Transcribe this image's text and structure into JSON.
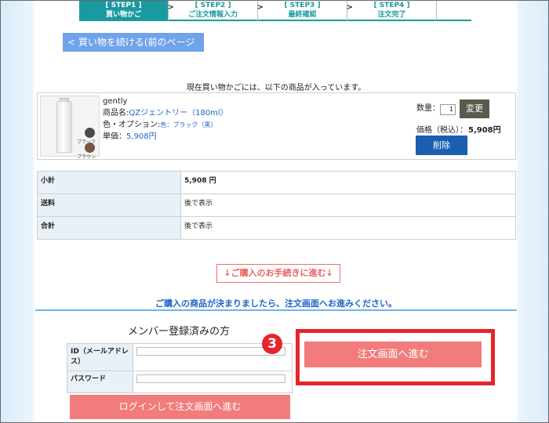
{
  "steps": [
    {
      "tag": "[ STEP1 ]",
      "label": "買い物かご",
      "active": true
    },
    {
      "tag": "[ STEP2 ]",
      "label": "ご注文情報入力",
      "active": false
    },
    {
      "tag": "[ STEP3 ]",
      "label": "最終確認",
      "active": false
    },
    {
      "tag": "[ STEP4 ]",
      "label": "注文完了",
      "active": false
    }
  ],
  "step_arrow": ">",
  "continue_shopping": "< 買い物を続ける(前のページへ)",
  "cart_message": "現在買い物かごには、以下の商品が入っています。",
  "product": {
    "brand": "gently",
    "name_label": "商品名:",
    "name": "QZジェントリー（180ml）",
    "option_label": "色・オプション:",
    "option_value": "色：ブラック（黒）",
    "unit_label": "単価：",
    "unit_price": "5,908円",
    "swatch1": "ブラック",
    "swatch2": "ブラウン",
    "qty_label": "数量：",
    "qty_value": "1",
    "change_label": "変更",
    "price_label": "価格（税込）：",
    "price_value": "5,908円",
    "delete_label": "削除"
  },
  "summary": [
    {
      "label": "小計",
      "value": "5,908 円"
    },
    {
      "label": "送料",
      "value": "後で表示"
    },
    {
      "label": "合計",
      "value": "後で表示"
    }
  ],
  "proceed_link": "↓ご購入のお手続きに進む↓",
  "decided_message": "ご購入の商品が決まりましたら、注文画面へお進みください。",
  "member": {
    "title": "メンバー登録済みの方",
    "id_label": "ID（メールアドレス）",
    "password_label": "パスワード",
    "login_button": "ログインして注文画面へ進む"
  },
  "order_button": "注文画面へ進む",
  "badge": "3",
  "colors": {
    "accent": "#1a9aa0",
    "highlight": "#e5252b",
    "button_pink": "#f27b7b"
  }
}
